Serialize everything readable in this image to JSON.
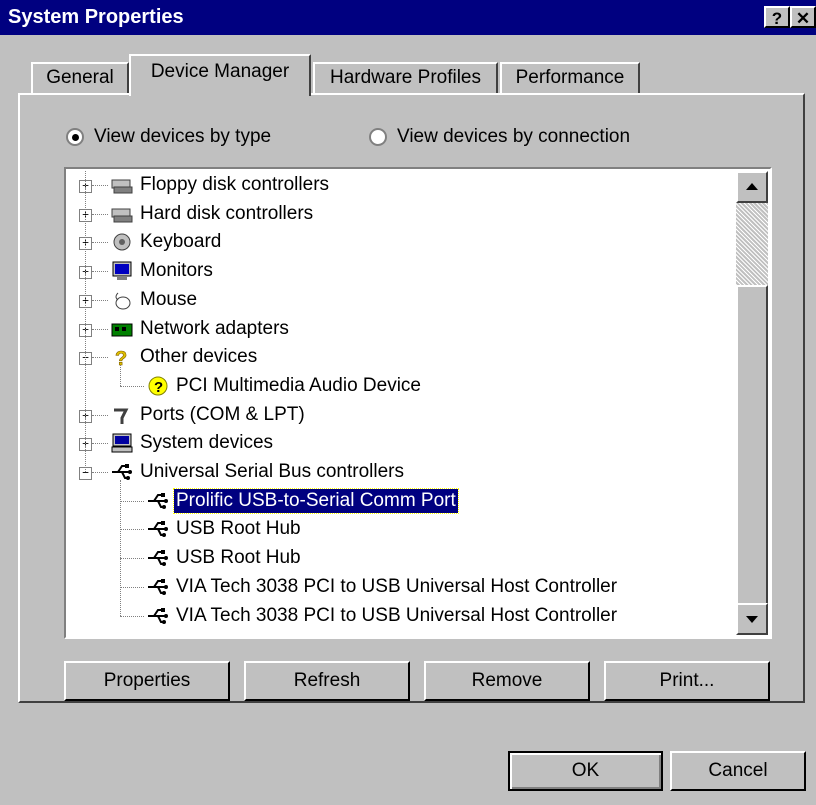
{
  "window": {
    "title": "System Properties",
    "help_label": "?",
    "close_label": "✕"
  },
  "tabs": [
    {
      "label": "General"
    },
    {
      "label": "Device Manager",
      "active": true
    },
    {
      "label": "Hardware Profiles"
    },
    {
      "label": "Performance"
    }
  ],
  "view": {
    "by_type_label": "View devices by type",
    "by_connection_label": "View devices by connection",
    "selected": "by_type"
  },
  "devices": [
    {
      "label": "Floppy disk controllers",
      "icon": "floppy-controller-icon",
      "expanded": false
    },
    {
      "label": "Hard disk controllers",
      "icon": "hard-disk-controller-icon",
      "expanded": false
    },
    {
      "label": "Keyboard",
      "icon": "keyboard-icon",
      "expanded": false
    },
    {
      "label": "Monitors",
      "icon": "monitor-icon",
      "expanded": false
    },
    {
      "label": "Mouse",
      "icon": "mouse-icon",
      "expanded": false
    },
    {
      "label": "Network adapters",
      "icon": "network-adapter-icon",
      "expanded": false
    },
    {
      "label": "Other devices",
      "icon": "question-mark-icon",
      "expanded": true
    },
    {
      "label": "PCI Multimedia Audio Device",
      "icon": "unknown-device-warning-icon",
      "child": true
    },
    {
      "label": "Ports (COM & LPT)",
      "icon": "port-icon",
      "expanded": false
    },
    {
      "label": "System devices",
      "icon": "system-devices-icon",
      "expanded": false
    },
    {
      "label": "Universal Serial Bus controllers",
      "icon": "usb-icon",
      "expanded": true
    },
    {
      "label": "Prolific USB-to-Serial Comm Port",
      "icon": "usb-icon",
      "child": true,
      "selected": true
    },
    {
      "label": "USB Root Hub",
      "icon": "usb-icon",
      "child": true
    },
    {
      "label": "USB Root Hub",
      "icon": "usb-icon",
      "child": true
    },
    {
      "label": "VIA Tech 3038 PCI to USB Universal Host Controller",
      "icon": "usb-icon",
      "child": true
    },
    {
      "label": "VIA Tech 3038 PCI to USB Universal Host Controller",
      "icon": "usb-icon",
      "child": true
    }
  ],
  "actions": {
    "properties": "Properties",
    "refresh": "Refresh",
    "remove": "Remove",
    "print": "Print..."
  },
  "dialog": {
    "ok": "OK",
    "cancel": "Cancel"
  },
  "colors": {
    "selection": "#000080",
    "face": "#c0c0c0"
  }
}
